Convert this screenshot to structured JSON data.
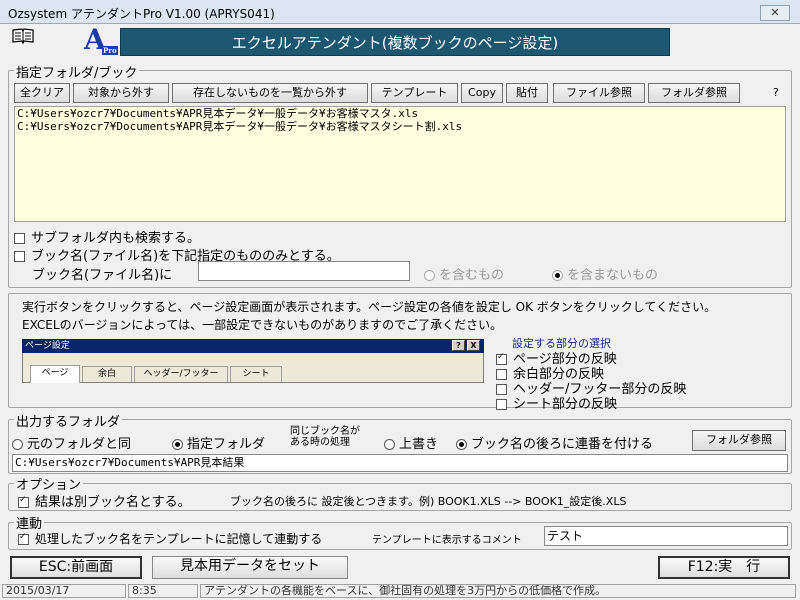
{
  "window": {
    "title": "Ozsystem アテンダントPro V1.00 (APRYS041)",
    "close": "✕"
  },
  "banner": {
    "title": "エクセルアテンダント(複数ブックのページ設定)",
    "logo": "A",
    "logo_sub": "Pro"
  },
  "folders": {
    "legend": "指定フォルダ/ブック",
    "toolbar": [
      "全クリア",
      "対象から外す",
      "存在しないものを一覧から外す",
      "テンプレート",
      "Copy",
      "貼付",
      "ファイル参照",
      "フォルダ参照"
    ],
    "help": "?",
    "items": [
      "C:¥Users¥ozcr7¥Documents¥APR見本データ¥一般データ¥お客様マスタ.xls",
      "C:¥Users¥ozcr7¥Documents¥APR見本データ¥一般データ¥お客様マスタシート割.xls"
    ],
    "subfolder_label": "サブフォルダ内も検索する。",
    "limit_label": "ブック名(ファイル名)を下記指定のもののみとする。",
    "bookname_label": "ブック名(ファイル名)に",
    "bookname_value": "",
    "opt_include": "を含むもの",
    "opt_exclude": "を含まないもの"
  },
  "info": {
    "line1": "実行ボタンをクリックすると、ページ設定画面が表示されます。ページ設定の各値を設定し OK ボタンをクリックしてください。",
    "line2": "EXCELのバージョンによっては、一部設定できないものがありますのでご了承ください。",
    "dialog_title": "ページ設定",
    "dialog_help": "?",
    "dialog_close": "X",
    "tabs": [
      "ページ",
      "余白",
      "ヘッダー/フッター",
      "シート"
    ],
    "section_title": "設定する部分の選択",
    "options": [
      {
        "label": "ページ部分の反映",
        "checked": true
      },
      {
        "label": "余白部分の反映",
        "checked": false
      },
      {
        "label": "ヘッダー/フッター部分の反映",
        "checked": false
      },
      {
        "label": "シート部分の反映",
        "checked": false
      }
    ]
  },
  "output": {
    "legend": "出力するフォルダ",
    "opt_original": "元のフォルダと同",
    "opt_specified": "指定フォルダ",
    "same_name_1": "同じブック名が",
    "same_name_2": "ある時の処理",
    "opt_overwrite": "上書き",
    "opt_serial": "ブック名の後ろに連番を付ける",
    "browse": "フォルダ参照",
    "path": "C:¥Users¥ozcr7¥Documents¥APR見本結果"
  },
  "option": {
    "legend": "オプション",
    "label": "結果は別ブック名とする。",
    "note": "ブック名の後ろに 設定後とつきます。例) BOOK1.XLS --> BOOK1_設定後.XLS"
  },
  "link": {
    "legend": "連動",
    "label": "処理したブック名をテンプレートに記憶して連動する",
    "comment_label": "テンプレートに表示するコメント",
    "comment_value": "テスト"
  },
  "buttons": {
    "back": "ESC:前画面",
    "sample": "見本用データをセット",
    "run": "F12:実　行"
  },
  "status": {
    "date": "2015/03/17",
    "time": "8:35",
    "message": "アテンダントの各機能をベースに、御社固有の処理を3万円からの低価格で作成。"
  }
}
